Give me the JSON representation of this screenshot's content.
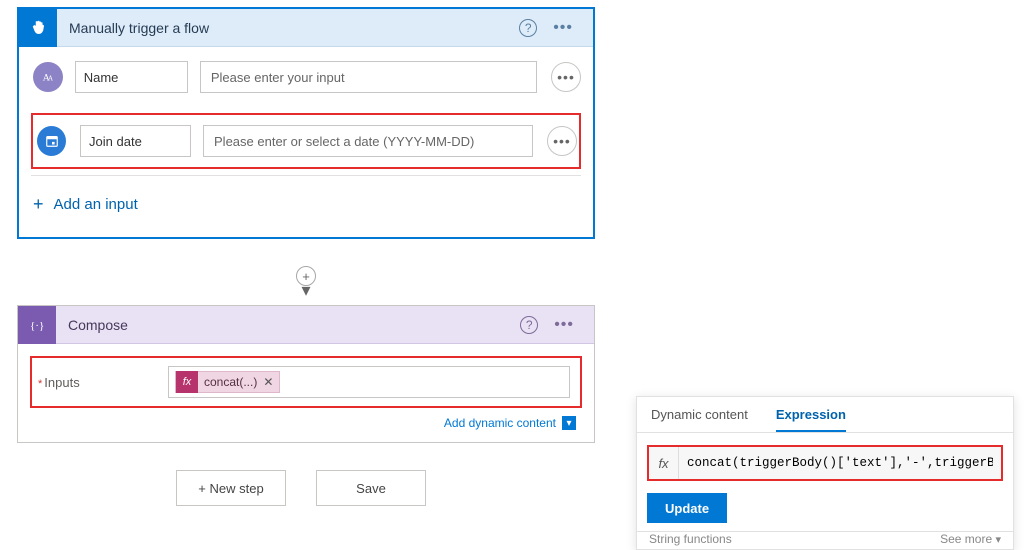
{
  "trigger": {
    "title": "Manually trigger a flow",
    "params": [
      {
        "label": "Name",
        "placeholder": "Please enter your input"
      },
      {
        "label": "Join date",
        "placeholder": "Please enter or select a date (YYYY-MM-DD)"
      }
    ],
    "add_input_label": "Add an input"
  },
  "compose": {
    "title": "Compose",
    "inputs_label": "Inputs",
    "token_prefix": "fx",
    "token_text": "concat(...)",
    "add_dynamic": "Add dynamic content"
  },
  "buttons": {
    "new_step": "+ New step",
    "save": "Save"
  },
  "expression_panel": {
    "tab_dynamic": "Dynamic content",
    "tab_expression": "Expression",
    "fx_label": "fx",
    "expression_value": "concat(triggerBody()['text'],'-',triggerBo",
    "update": "Update",
    "section_title": "String functions",
    "see_more": "See more"
  }
}
